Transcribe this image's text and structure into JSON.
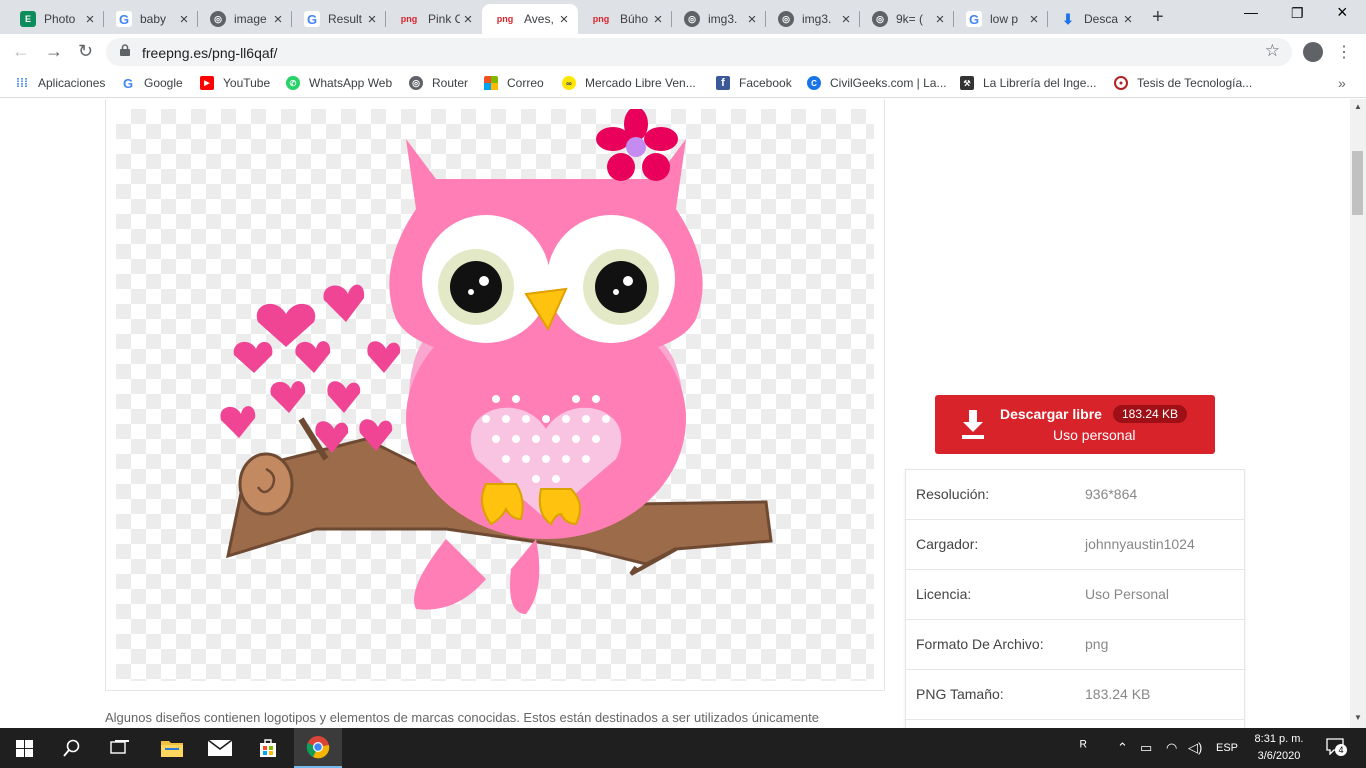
{
  "browser": {
    "tabs": [
      {
        "title": "Photo",
        "icon": "photo-editor-icon",
        "color": "#0e8c5c",
        "active": false
      },
      {
        "title": "baby",
        "icon": "google-icon",
        "color": "#4285f4",
        "active": false
      },
      {
        "title": "image",
        "icon": "globe-icon",
        "color": "#5f6368",
        "active": false
      },
      {
        "title": "Result",
        "icon": "google-icon",
        "color": "#4285f4",
        "active": false
      },
      {
        "title": "Pink C",
        "icon": "png-icon",
        "color": "#d9232b",
        "active": false
      },
      {
        "title": "Aves,",
        "icon": "png-icon",
        "color": "#d9232b",
        "active": true
      },
      {
        "title": "Búho",
        "icon": "png-icon",
        "color": "#d9232b",
        "active": false
      },
      {
        "title": "img3.",
        "icon": "globe-icon",
        "color": "#5f6368",
        "active": false
      },
      {
        "title": "img3.",
        "icon": "globe-icon",
        "color": "#5f6368",
        "active": false
      },
      {
        "title": "9k= (",
        "icon": "globe-icon",
        "color": "#5f6368",
        "active": false
      },
      {
        "title": "low p",
        "icon": "google-icon",
        "color": "#4285f4",
        "active": false
      },
      {
        "title": "Desca",
        "icon": "download-icon",
        "color": "#1a73e8",
        "active": false
      }
    ],
    "url": "freepng.es/png-ll6qaf/",
    "bookmarks": [
      {
        "label": "Aplicaciones",
        "icon": "apps-grid-icon"
      },
      {
        "label": "Google",
        "icon": "google-icon"
      },
      {
        "label": "YouTube",
        "icon": "youtube-icon"
      },
      {
        "label": "WhatsApp Web",
        "icon": "whatsapp-icon"
      },
      {
        "label": "Router",
        "icon": "globe-icon"
      },
      {
        "label": "Correo",
        "icon": "microsoft-icon"
      },
      {
        "label": "Mercado Libre Ven...",
        "icon": "mercadolibre-icon"
      },
      {
        "label": "Facebook",
        "icon": "facebook-icon"
      },
      {
        "label": "CivilGeeks.com | La...",
        "icon": "civilgeeks-icon"
      },
      {
        "label": "La Librería del Inge...",
        "icon": "engineer-icon"
      },
      {
        "label": "Tesis de Tecnología...",
        "icon": "tesis-icon"
      }
    ]
  },
  "page": {
    "disclaimer": "Algunos diseños contienen logotipos y elementos de marcas conocidas. Estos están destinados a ser utilizados únicamente",
    "download": {
      "label": "Descargar libre",
      "size": "183.24 KB",
      "usage": "Uso personal"
    },
    "info": [
      {
        "key": "Resolución:",
        "value": "936*864"
      },
      {
        "key": "Cargador:",
        "value": "johnnyaustin1024"
      },
      {
        "key": "Licencia:",
        "value": "Uso Personal"
      },
      {
        "key": "Formato De Archivo:",
        "value": "png"
      },
      {
        "key": "PNG Tamaño:",
        "value": "183.24 KB"
      }
    ],
    "accent_color": "#d9232b"
  },
  "taskbar": {
    "language": "ESP",
    "time": "8:31 p. m.",
    "date": "3/6/2020",
    "notifications": "4"
  }
}
